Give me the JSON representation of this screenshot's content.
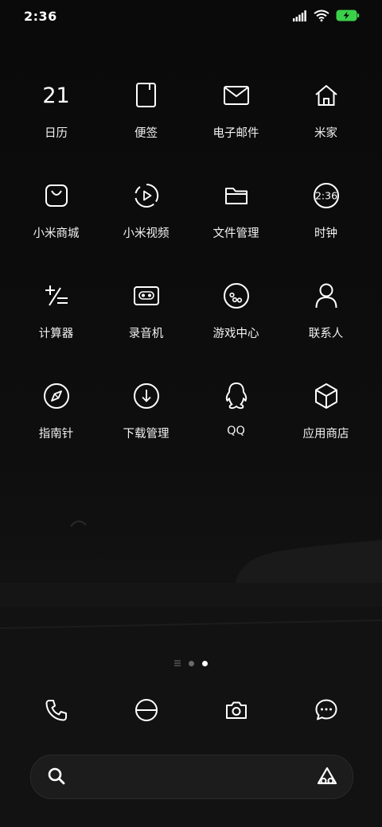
{
  "status_bar": {
    "time": "2:36",
    "icons": [
      "signal-icon",
      "wifi-icon",
      "battery-charging-icon"
    ],
    "battery_color": "#3ad04a"
  },
  "home_screen": {
    "calendar_day": "21",
    "clock_icon_text": "2:36",
    "apps": [
      {
        "label": "日历",
        "icon": "calendar-icon"
      },
      {
        "label": "便签",
        "icon": "notes-icon"
      },
      {
        "label": "电子邮件",
        "icon": "mail-icon"
      },
      {
        "label": "米家",
        "icon": "home-icon"
      },
      {
        "label": "小米商城",
        "icon": "shopping-bag-icon"
      },
      {
        "label": "小米视频",
        "icon": "video-icon"
      },
      {
        "label": "文件管理",
        "icon": "folder-icon"
      },
      {
        "label": "时钟",
        "icon": "clock-icon"
      },
      {
        "label": "计算器",
        "icon": "calculator-icon"
      },
      {
        "label": "录音机",
        "icon": "recorder-icon"
      },
      {
        "label": "游戏中心",
        "icon": "game-center-icon"
      },
      {
        "label": "联系人",
        "icon": "contacts-icon"
      },
      {
        "label": "指南针",
        "icon": "compass-icon"
      },
      {
        "label": "下载管理",
        "icon": "download-icon"
      },
      {
        "label": "QQ",
        "icon": "qq-icon"
      },
      {
        "label": "应用商店",
        "icon": "app-store-icon"
      }
    ],
    "page_indicator": {
      "pages": 3,
      "current": 3
    }
  },
  "dock": {
    "icons": [
      "phone-icon",
      "browser-icon",
      "camera-icon",
      "messages-icon"
    ]
  },
  "search_bar": {
    "icons": [
      "search-icon",
      "assistant-icon"
    ]
  },
  "colors": {
    "background": "#0c0c0c",
    "icon_stroke": "#ffffff",
    "search_bg": "#1e1e1e"
  }
}
